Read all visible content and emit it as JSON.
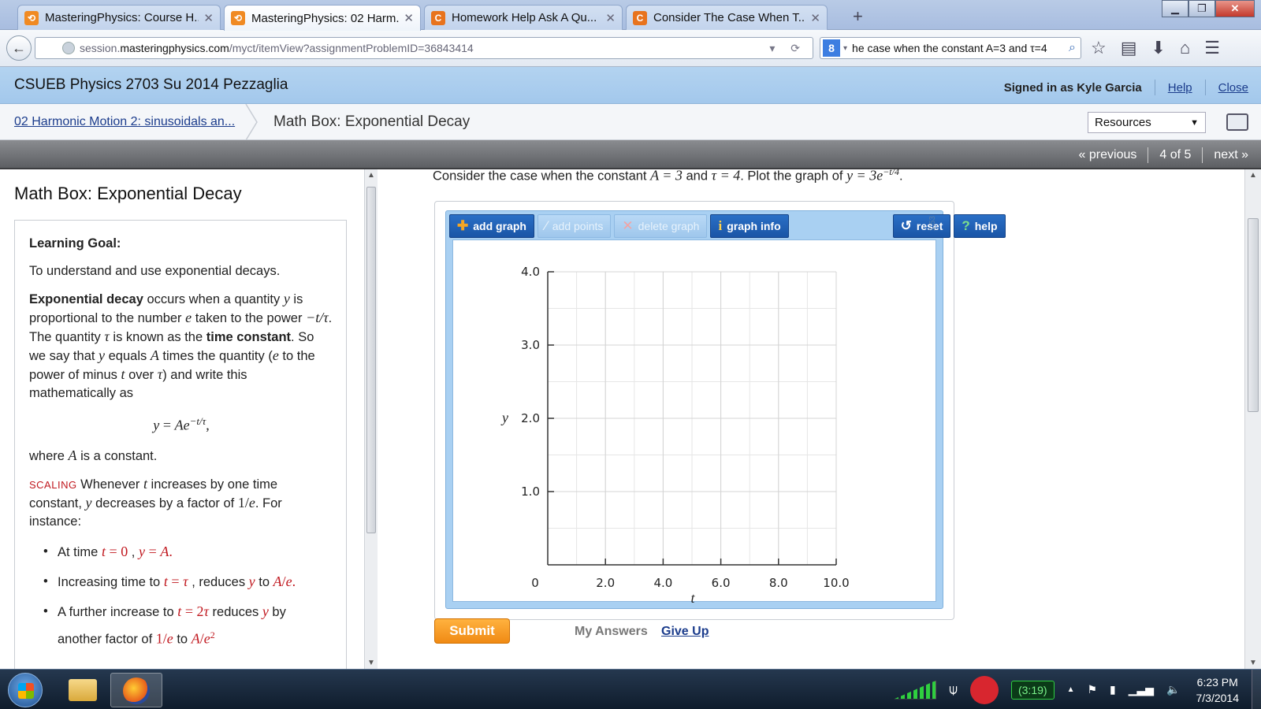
{
  "browser": {
    "tabs": [
      {
        "label": "MasteringPhysics: Course H...",
        "favicon": "MP",
        "active": false
      },
      {
        "label": "MasteringPhysics: 02 Harm...",
        "favicon": "MP",
        "active": true
      },
      {
        "label": "Homework Help Ask A Qu...",
        "favicon": "C",
        "active": false
      },
      {
        "label": "Consider The Case When T...",
        "favicon": "C",
        "active": false
      }
    ],
    "url_prefix": "session.",
    "url_host": "masteringphysics.com",
    "url_path": "/myct/itemView?assignmentProblemID=36843414",
    "search_text": "he case when the constant A=3 and τ=4",
    "search_engine": "8"
  },
  "header": {
    "course_title": "CSUEB Physics 2703 Su 2014 Pezzaglia",
    "signed_in": "Signed in as Kyle Garcia",
    "help": "Help",
    "close": "Close"
  },
  "breadcrumb": {
    "link": "02 Harmonic Motion 2: sinusoidals an...",
    "current": "Math Box: Exponential Decay",
    "resources_label": "Resources"
  },
  "pager": {
    "previous": "« previous",
    "position": "4 of 5",
    "next": "next »"
  },
  "left": {
    "title": "Math Box: Exponential Decay",
    "learning_goal_heading": "Learning Goal:",
    "learning_goal_text": "To understand and use exponential decays."
  },
  "question": {
    "prefix": "Consider the case when the constant ",
    "a_eq": "A = 3",
    "and": " and ",
    "tau_eq": "τ = 4",
    "plot_text": ". Plot the graph of ",
    "y_eq": "y = 3e",
    "exponent": "−t/4",
    "suffix": "."
  },
  "toolbar": {
    "add_graph": "add graph",
    "add_points": "add points",
    "delete_graph": "delete graph",
    "graph_info": "graph info",
    "reset": "reset",
    "help": "help",
    "version": "1.53"
  },
  "chart_data": {
    "type": "line",
    "xlabel": "t",
    "ylabel": "y",
    "xlim": [
      0,
      10
    ],
    "ylim": [
      0,
      4
    ],
    "x_ticks": [
      "2.0",
      "4.0",
      "6.0",
      "8.0",
      "10.0"
    ],
    "y_ticks": [
      "1.0",
      "2.0",
      "3.0",
      "4.0"
    ],
    "origin_label": "0",
    "grid": true,
    "series": []
  },
  "actions": {
    "submit": "Submit",
    "my_answers": "My Answers",
    "give_up": "Give Up"
  },
  "taskbar": {
    "timer": "(3:19)",
    "time": "6:23 PM",
    "date": "7/3/2014"
  }
}
